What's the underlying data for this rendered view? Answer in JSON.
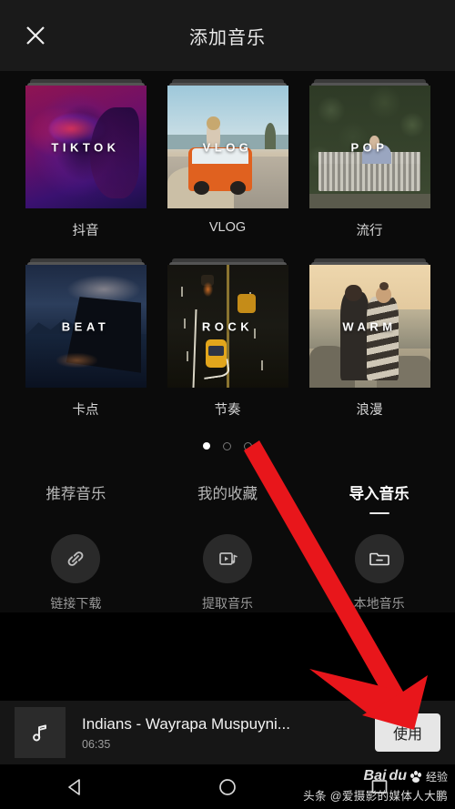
{
  "header": {
    "title": "添加音乐",
    "close_icon": "close-icon"
  },
  "categories": {
    "rows": [
      [
        {
          "word": "TIKTOK",
          "label": "抖音",
          "art": "tiktok"
        },
        {
          "word": "VLOG",
          "label": "VLOG",
          "art": "vlog"
        },
        {
          "word": "POP",
          "label": "流行",
          "art": "pop"
        }
      ],
      [
        {
          "word": "BEAT",
          "label": "卡点",
          "art": "beat"
        },
        {
          "word": "ROCK",
          "label": "节奏",
          "art": "rock"
        },
        {
          "word": "WARM",
          "label": "浪漫",
          "art": "warm"
        }
      ]
    ]
  },
  "pager": {
    "count": 3,
    "active_index": 0
  },
  "tabs": [
    {
      "label": "推荐音乐",
      "active": false
    },
    {
      "label": "我的收藏",
      "active": false
    },
    {
      "label": "导入音乐",
      "active": true
    }
  ],
  "import_actions": [
    {
      "label": "链接下载",
      "icon": "link-icon"
    },
    {
      "label": "提取音乐",
      "icon": "video-to-music-icon"
    },
    {
      "label": "本地音乐",
      "icon": "folder-icon"
    }
  ],
  "player": {
    "title": "Indians - Wayrapa Muspuyni...",
    "duration": "06:35",
    "thumb_icon": "music-note-icon",
    "use_label": "使用"
  },
  "navbar": [
    {
      "name": "back",
      "icon": "triangle-back-icon"
    },
    {
      "name": "home",
      "icon": "circle-home-icon"
    },
    {
      "name": "recents",
      "icon": "square-recents-icon"
    }
  ],
  "watermarks": {
    "baidu": "Bai",
    "baidu_suffix": "du",
    "baidu_jingyan": "经验",
    "toutiao": "头条 @爱摄影的媒体人大鹏"
  },
  "annotation": {
    "arrow_color": "#e8161b"
  }
}
